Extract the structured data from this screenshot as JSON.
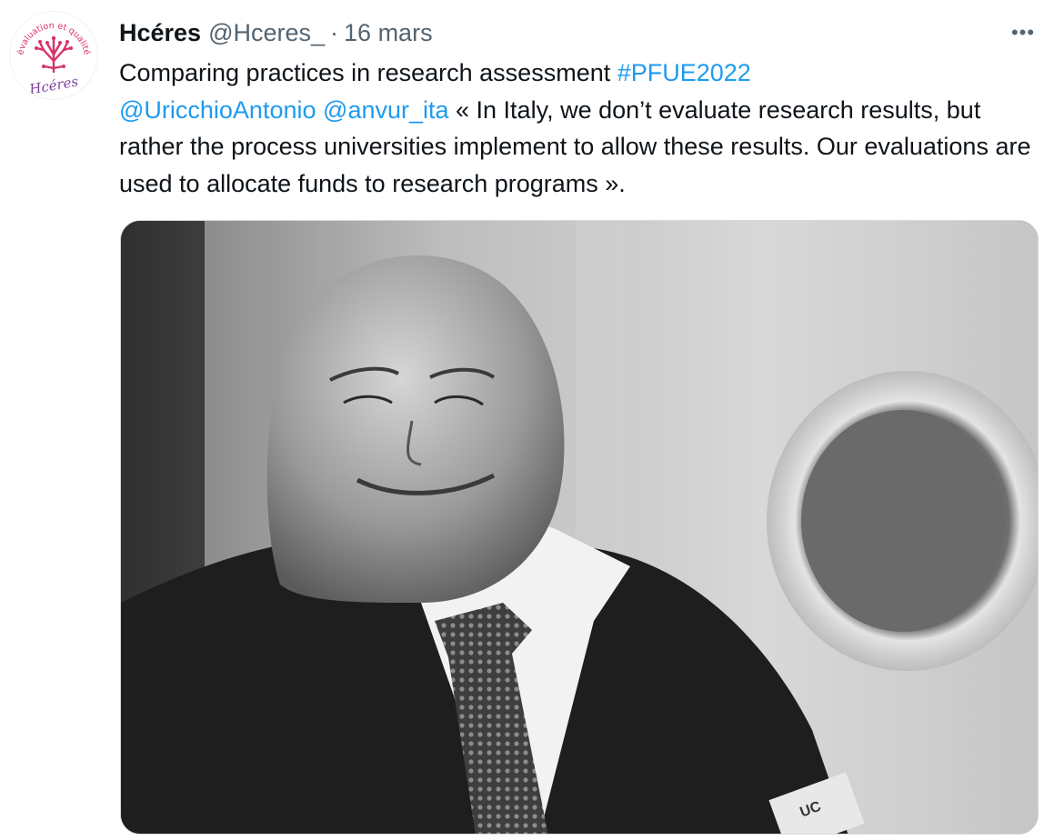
{
  "tweet": {
    "author": {
      "display_name": "Hcéres",
      "handle": "@Hceres_",
      "avatar_text_top": "évaluation et qualité",
      "avatar_text_bottom": "Hcéres"
    },
    "separator": "·",
    "date": "16 mars",
    "more_label": "•••",
    "body": {
      "part1": "Comparing practices in research assessment ",
      "hashtag": "#PFUE2022",
      "mention1": "@UricchioAntonio",
      "space": " ",
      "mention2": "@anvur_ita",
      "part2": " « In Italy, we don’t evaluate research results, but rather the process universities implement to allow these results. Our evaluations are used to allocate funds to research programs »."
    },
    "media": {
      "kind": "photo",
      "badge_text": "UC"
    }
  },
  "colors": {
    "link": "#1d9bf0",
    "secondary_text": "#536471",
    "primary_text": "#0f1419",
    "logo_pink": "#d6336c",
    "logo_purple": "#7b3fa0"
  }
}
